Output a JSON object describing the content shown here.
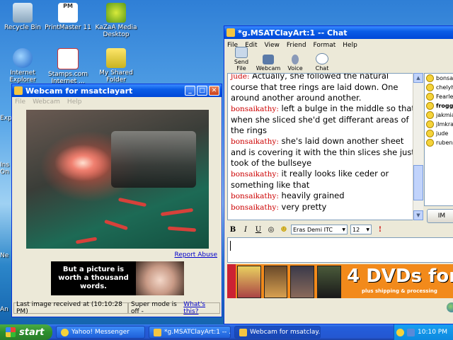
{
  "desktop": {
    "icons": [
      {
        "label": "Recycle Bin"
      },
      {
        "label": "PrintMaster 11"
      },
      {
        "label": "KaZaA Media Desktop"
      },
      {
        "label": "Internet Explorer"
      },
      {
        "label": "Stamps.com Internet ..."
      },
      {
        "label": "My Shared Folder"
      }
    ],
    "edge_labels": [
      "Exp",
      "Ins On",
      "Ne",
      "An"
    ],
    "icon_badge": "PM"
  },
  "webcam": {
    "title": "Webcam for msatclayart",
    "menu": [
      "File",
      "Webcam",
      "Help"
    ],
    "report_abuse": "Report Abuse",
    "ad_text": "But a picture is worth a thousand words.",
    "status_last": "Last image received at (10:10:28 PM)",
    "status_super": "Super mode is off - ",
    "status_whats": "What's this?"
  },
  "chat": {
    "title": "*g.MSATClayArt:1 -- Chat",
    "menu": [
      "File",
      "Edit",
      "View",
      "Friend",
      "Format",
      "Help"
    ],
    "tools": [
      "Send File",
      "Webcam",
      "Voice",
      "Chat"
    ],
    "messages": [
      {
        "nick": "jude:",
        "text": " Actually, she followed the natural course that tree rings are laid down. One around another around another."
      },
      {
        "nick": "bonsaikathy:",
        "text": " left a bulge in the middle so that when she sliced she'd get differant areas of the rings"
      },
      {
        "nick": "bonsaikathy:",
        "text": " she's laid down another sheet and is covering it with the thin slices she just took of the bullseye"
      },
      {
        "nick": "bonsaikathy:",
        "text": " it really looks like ceder or something like that"
      },
      {
        "nick": "bonsaikathy:",
        "text": " heavily grained"
      },
      {
        "nick": "bonsaikathy:",
        "text": " very pretty"
      }
    ],
    "friends": [
      {
        "name": "bonsa",
        "bold": false
      },
      {
        "name": "chelyh",
        "bold": false
      },
      {
        "name": "Fearle",
        "bold": false
      },
      {
        "name": "frogg",
        "bold": true
      },
      {
        "name": "jakmia",
        "bold": false
      },
      {
        "name": "jlmkra",
        "bold": false
      },
      {
        "name": "jude",
        "bold": false
      },
      {
        "name": "rubens",
        "bold": false
      }
    ],
    "im_button": "IM",
    "format": {
      "bold": "B",
      "italic": "I",
      "underline": "U",
      "font": "Eras Demi ITC",
      "size": "12"
    },
    "ad": {
      "big": "4 DVDs for",
      "sub": "plus shipping & processing"
    }
  },
  "taskbar": {
    "start": "start",
    "tasks": [
      "Yahoo! Messenger",
      "*g.MSATClayArt:1 -- ...",
      "Webcam for msatclay..."
    ],
    "clock": "10:10 PM"
  },
  "colors": {
    "nick": "#cc0000",
    "title_bar": "#0a5ce6",
    "taskbar": "#245edb",
    "start": "#2d8f2d"
  }
}
